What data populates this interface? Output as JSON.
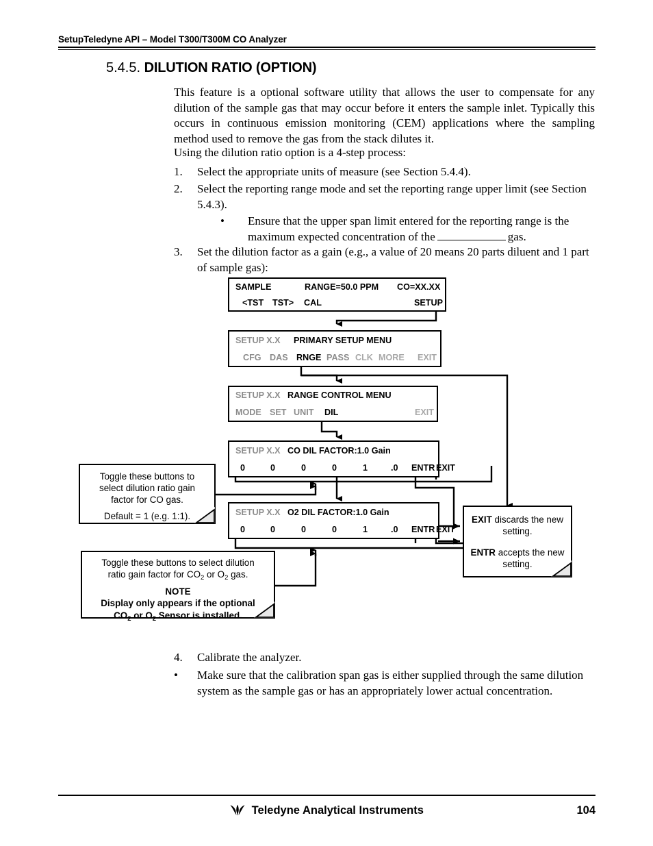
{
  "header": {
    "text": "SetupTeledyne API – Model T300/T300M CO Analyzer"
  },
  "section": {
    "number": "5.4.5.",
    "title": "DILUTION RATIO (OPTION)"
  },
  "body": {
    "intro": "This feature is a optional software utility that allows the user to compensate for any dilution of the sample gas that may occur before it enters the sample inlet. Typically this occurs in continuous emission monitoring (CEM) applications where the sampling method used to remove the gas from the stack dilutes it.",
    "using_line": "Using the dilution ratio option is a 4-step process:",
    "step1_marker": "1.",
    "step1": "Select the appropriate units of measure (see Section 5.4.4).",
    "step2_marker": "2.",
    "step2": "Select the reporting range mode and set the reporting range upper limit (see Section 5.4.3).",
    "bullet1_marker": "•",
    "bullet1_part1": "Ensure that the upper span limit entered for the reporting range is the maximum expected concentration of the",
    "bullet1_part2": "gas.",
    "step3_marker": "3.",
    "step3": "Set the dilution factor as a gain (e.g., a value of 20 means 20 parts diluent and 1 part of sample gas):",
    "step4_marker": "4.",
    "step4": "Calibrate the analyzer.",
    "bullet2_marker": "•",
    "bullet2": "Make sure that the calibration span gas is either supplied through the same dilution system as the sample gas or has an appropriately lower actual concentration."
  },
  "flowchart": {
    "display_sample": {
      "top": {
        "mode": "SAMPLE",
        "range": "RANGE=50.0 PPM",
        "conc": "CO=XX.XX"
      },
      "bottom": {
        "tst_prev": "<TST",
        "tst_next": "TST>",
        "cal": "CAL",
        "setup": "SETUP"
      }
    },
    "display_primary_setup": {
      "top": {
        "setup_label": "SETUP X.X",
        "title": "PRIMARY SETUP MENU"
      },
      "bottom": {
        "cfg": "CFG",
        "das": "DAS",
        "rnge": "RNGE",
        "pass": "PASS",
        "clk": "CLK",
        "more": "MORE",
        "exit": "EXIT"
      }
    },
    "display_range_control": {
      "top": {
        "setup_label": "SETUP X.X",
        "title": "RANGE CONTROL MENU"
      },
      "bottom": {
        "mode": "MODE",
        "set": "SET",
        "unit": "UNIT",
        "dil": "DIL",
        "exit": "EXIT"
      }
    },
    "display_co_dil": {
      "top": {
        "setup_label": "SETUP X.X",
        "title": "CO DIL FACTOR:1.0 Gain"
      },
      "bottom": {
        "digits": [
          "0",
          "0",
          "0",
          "0",
          "1",
          ".0"
        ],
        "entr": "ENTR",
        "exit": "EXIT"
      }
    },
    "display_o2_dil": {
      "top": {
        "setup_label": "SETUP X.X",
        "title": "O2 DIL FACTOR:1.0 Gain"
      },
      "bottom": {
        "digits": [
          "0",
          "0",
          "0",
          "0",
          "1",
          ".0"
        ],
        "entr": "ENTR",
        "exit": "EXIT"
      }
    },
    "note_co": {
      "line1": "Toggle these buttons to",
      "line2": "select dilution ratio gain",
      "line3": "factor for CO gas.",
      "line4": "Default = 1 (e.g. 1:1)."
    },
    "note_co2_o2": {
      "line1": "Toggle these buttons to select dilution",
      "line2_a": "ratio gain factor for CO",
      "line2_sub1": "2",
      "line2_b": " or O",
      "line2_sub2": "2",
      "line2_c": " gas.",
      "note_label": "NOTE",
      "line3": "Display only appears if the optional",
      "line4_a": "CO",
      "line4_sub1": "2",
      "line4_b": " or O",
      "line4_sub2": "2",
      "line4_c": " Sensor is installed."
    },
    "note_exit_entr": {
      "exit_bold": "EXIT",
      "exit_rest": " discards the new setting.",
      "entr_bold": "ENTR",
      "entr_rest": " accepts the new setting."
    }
  },
  "footer": {
    "company": "Teledyne Analytical Instruments",
    "page": "104"
  },
  "colors": {
    "ink": "#000000",
    "inactive_gray": "#8c8c8c",
    "inactive_gray_light": "#a8a8a8"
  }
}
